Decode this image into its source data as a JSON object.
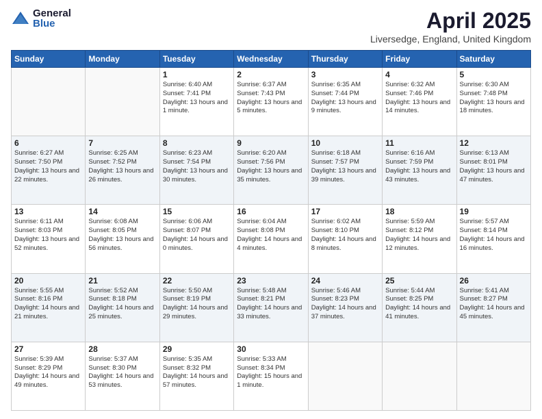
{
  "header": {
    "logo_general": "General",
    "logo_blue": "Blue",
    "title": "April 2025",
    "subtitle": "Liversedge, England, United Kingdom"
  },
  "weekdays": [
    "Sunday",
    "Monday",
    "Tuesday",
    "Wednesday",
    "Thursday",
    "Friday",
    "Saturday"
  ],
  "weeks": [
    [
      {
        "day": "",
        "info": ""
      },
      {
        "day": "",
        "info": ""
      },
      {
        "day": "1",
        "info": "Sunrise: 6:40 AM\nSunset: 7:41 PM\nDaylight: 13 hours and 1 minute."
      },
      {
        "day": "2",
        "info": "Sunrise: 6:37 AM\nSunset: 7:43 PM\nDaylight: 13 hours and 5 minutes."
      },
      {
        "day": "3",
        "info": "Sunrise: 6:35 AM\nSunset: 7:44 PM\nDaylight: 13 hours and 9 minutes."
      },
      {
        "day": "4",
        "info": "Sunrise: 6:32 AM\nSunset: 7:46 PM\nDaylight: 13 hours and 14 minutes."
      },
      {
        "day": "5",
        "info": "Sunrise: 6:30 AM\nSunset: 7:48 PM\nDaylight: 13 hours and 18 minutes."
      }
    ],
    [
      {
        "day": "6",
        "info": "Sunrise: 6:27 AM\nSunset: 7:50 PM\nDaylight: 13 hours and 22 minutes."
      },
      {
        "day": "7",
        "info": "Sunrise: 6:25 AM\nSunset: 7:52 PM\nDaylight: 13 hours and 26 minutes."
      },
      {
        "day": "8",
        "info": "Sunrise: 6:23 AM\nSunset: 7:54 PM\nDaylight: 13 hours and 30 minutes."
      },
      {
        "day": "9",
        "info": "Sunrise: 6:20 AM\nSunset: 7:56 PM\nDaylight: 13 hours and 35 minutes."
      },
      {
        "day": "10",
        "info": "Sunrise: 6:18 AM\nSunset: 7:57 PM\nDaylight: 13 hours and 39 minutes."
      },
      {
        "day": "11",
        "info": "Sunrise: 6:16 AM\nSunset: 7:59 PM\nDaylight: 13 hours and 43 minutes."
      },
      {
        "day": "12",
        "info": "Sunrise: 6:13 AM\nSunset: 8:01 PM\nDaylight: 13 hours and 47 minutes."
      }
    ],
    [
      {
        "day": "13",
        "info": "Sunrise: 6:11 AM\nSunset: 8:03 PM\nDaylight: 13 hours and 52 minutes."
      },
      {
        "day": "14",
        "info": "Sunrise: 6:08 AM\nSunset: 8:05 PM\nDaylight: 13 hours and 56 minutes."
      },
      {
        "day": "15",
        "info": "Sunrise: 6:06 AM\nSunset: 8:07 PM\nDaylight: 14 hours and 0 minutes."
      },
      {
        "day": "16",
        "info": "Sunrise: 6:04 AM\nSunset: 8:08 PM\nDaylight: 14 hours and 4 minutes."
      },
      {
        "day": "17",
        "info": "Sunrise: 6:02 AM\nSunset: 8:10 PM\nDaylight: 14 hours and 8 minutes."
      },
      {
        "day": "18",
        "info": "Sunrise: 5:59 AM\nSunset: 8:12 PM\nDaylight: 14 hours and 12 minutes."
      },
      {
        "day": "19",
        "info": "Sunrise: 5:57 AM\nSunset: 8:14 PM\nDaylight: 14 hours and 16 minutes."
      }
    ],
    [
      {
        "day": "20",
        "info": "Sunrise: 5:55 AM\nSunset: 8:16 PM\nDaylight: 14 hours and 21 minutes."
      },
      {
        "day": "21",
        "info": "Sunrise: 5:52 AM\nSunset: 8:18 PM\nDaylight: 14 hours and 25 minutes."
      },
      {
        "day": "22",
        "info": "Sunrise: 5:50 AM\nSunset: 8:19 PM\nDaylight: 14 hours and 29 minutes."
      },
      {
        "day": "23",
        "info": "Sunrise: 5:48 AM\nSunset: 8:21 PM\nDaylight: 14 hours and 33 minutes."
      },
      {
        "day": "24",
        "info": "Sunrise: 5:46 AM\nSunset: 8:23 PM\nDaylight: 14 hours and 37 minutes."
      },
      {
        "day": "25",
        "info": "Sunrise: 5:44 AM\nSunset: 8:25 PM\nDaylight: 14 hours and 41 minutes."
      },
      {
        "day": "26",
        "info": "Sunrise: 5:41 AM\nSunset: 8:27 PM\nDaylight: 14 hours and 45 minutes."
      }
    ],
    [
      {
        "day": "27",
        "info": "Sunrise: 5:39 AM\nSunset: 8:29 PM\nDaylight: 14 hours and 49 minutes."
      },
      {
        "day": "28",
        "info": "Sunrise: 5:37 AM\nSunset: 8:30 PM\nDaylight: 14 hours and 53 minutes."
      },
      {
        "day": "29",
        "info": "Sunrise: 5:35 AM\nSunset: 8:32 PM\nDaylight: 14 hours and 57 minutes."
      },
      {
        "day": "30",
        "info": "Sunrise: 5:33 AM\nSunset: 8:34 PM\nDaylight: 15 hours and 1 minute."
      },
      {
        "day": "",
        "info": ""
      },
      {
        "day": "",
        "info": ""
      },
      {
        "day": "",
        "info": ""
      }
    ]
  ]
}
